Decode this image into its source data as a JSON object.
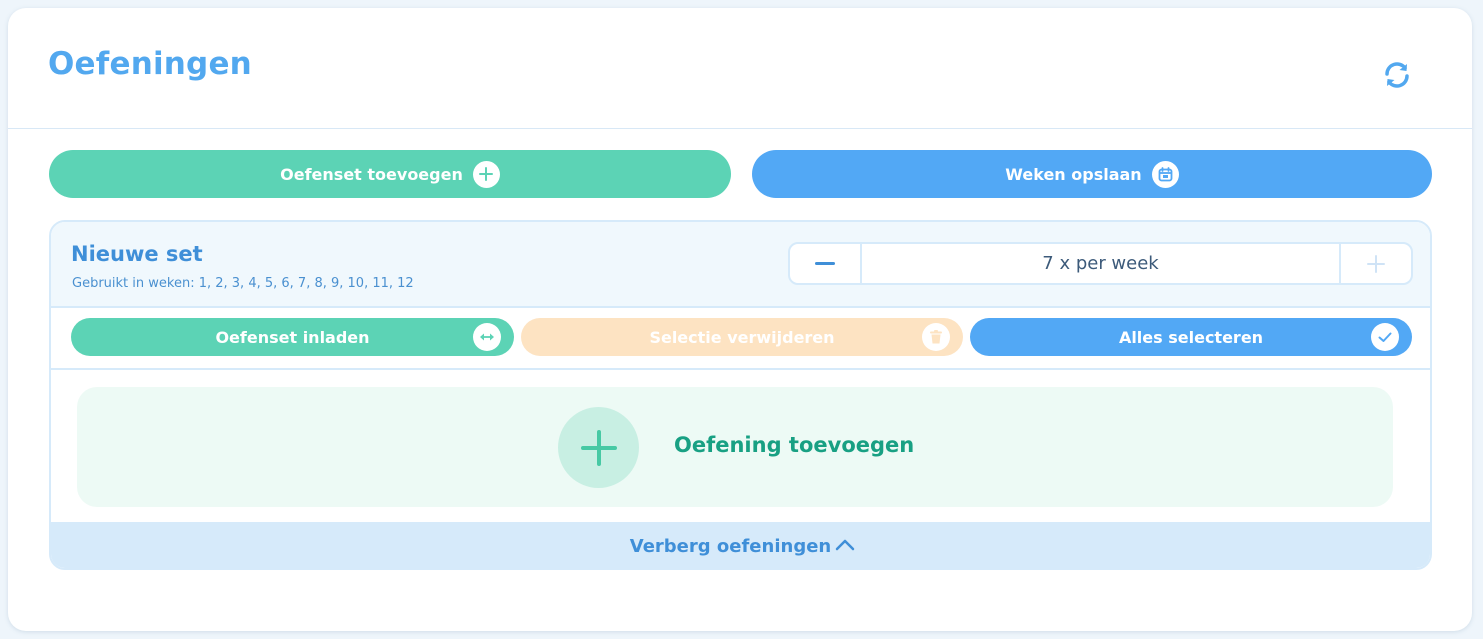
{
  "header": {
    "title": "Oefeningen",
    "refresh_icon": "refresh-icon"
  },
  "toolbar": {
    "add_set_label": "Oefenset toevoegen",
    "add_set_icon": "plus-circle-icon",
    "save_weeks_label": "Weken opslaan",
    "save_weeks_icon": "calendar-icon"
  },
  "set": {
    "title": "Nieuwe set",
    "used_in_weeks": "Gebruikt in weken: 1, 2, 3, 4, 5, 6, 7, 8, 9, 10, 11, 12",
    "frequency": "7 x per week",
    "actions": {
      "load_label": "Oefenset inladen",
      "load_icon": "swap-icon",
      "delete_label": "Selectie verwijderen",
      "delete_icon": "trash-icon",
      "select_all_label": "Alles selecteren",
      "select_all_icon": "check-icon"
    },
    "add_exercise_label": "Oefening toevoegen",
    "hide_label": "Verberg oefeningen"
  },
  "colors": {
    "title_blue": "#52a8ef",
    "green": "#5cd3b5",
    "blue": "#52a8f5",
    "peach": "#fde3c2",
    "add_text": "#18a083"
  }
}
